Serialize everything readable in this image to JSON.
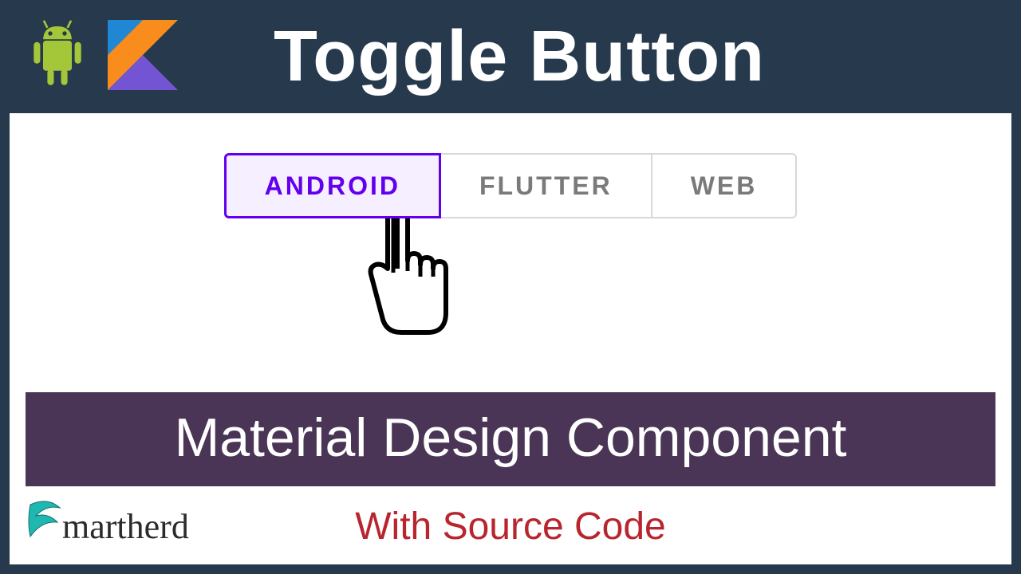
{
  "header": {
    "title": "Toggle Button"
  },
  "toggle": {
    "options": [
      {
        "label": "ANDROID",
        "selected": true
      },
      {
        "label": "FLUTTER",
        "selected": false
      },
      {
        "label": "WEB",
        "selected": false
      }
    ]
  },
  "subtitle": "Material Design Component",
  "footer": {
    "brand": "martherd",
    "source_code": "With Source Code"
  },
  "icons": {
    "android": "android-icon",
    "kotlin": "kotlin-icon",
    "cursor": "pointer-cursor-icon",
    "brand": "smartherd-logo-icon"
  }
}
